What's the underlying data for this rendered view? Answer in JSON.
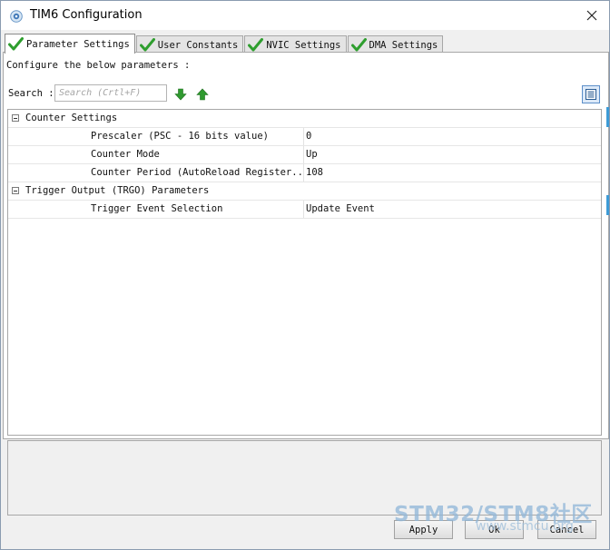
{
  "window": {
    "title": "TIM6 Configuration",
    "title_icon": "stm32cube-gear-icon",
    "close_icon": "close-icon"
  },
  "tabs": [
    {
      "label": "Parameter Settings",
      "active": true,
      "icon": "checkmark-icon"
    },
    {
      "label": "User Constants",
      "active": false,
      "icon": "checkmark-icon"
    },
    {
      "label": "NVIC Settings",
      "active": false,
      "icon": "checkmark-icon"
    },
    {
      "label": "DMA Settings",
      "active": false,
      "icon": "checkmark-icon"
    }
  ],
  "panel": {
    "configure_label": "Configure the below parameters :",
    "search_label": "Search :",
    "search_placeholder": "Search (Crtl+F)",
    "search_value": ""
  },
  "groups": [
    {
      "label": "Counter Settings",
      "expanded": true,
      "params": [
        {
          "name": "Prescaler (PSC - 16 bits value)",
          "value": "0"
        },
        {
          "name": "Counter Mode",
          "value": "Up"
        },
        {
          "name": "Counter Period (AutoReload Register...",
          "value": "108"
        }
      ]
    },
    {
      "label": "Trigger Output (TRGO) Parameters",
      "expanded": true,
      "params": [
        {
          "name": "Trigger Event Selection",
          "value": "Update Event"
        }
      ]
    }
  ],
  "buttons": {
    "apply": "Apply",
    "ok": "Ok",
    "cancel": "Cancel"
  },
  "watermark": {
    "brand": "STM32/STM8社区",
    "url": "www.stmcu.org"
  },
  "colors": {
    "check_green": "#2e9e2e",
    "arrow_green": "#2f9a2f",
    "accent_blue": "#3d9bd6"
  }
}
